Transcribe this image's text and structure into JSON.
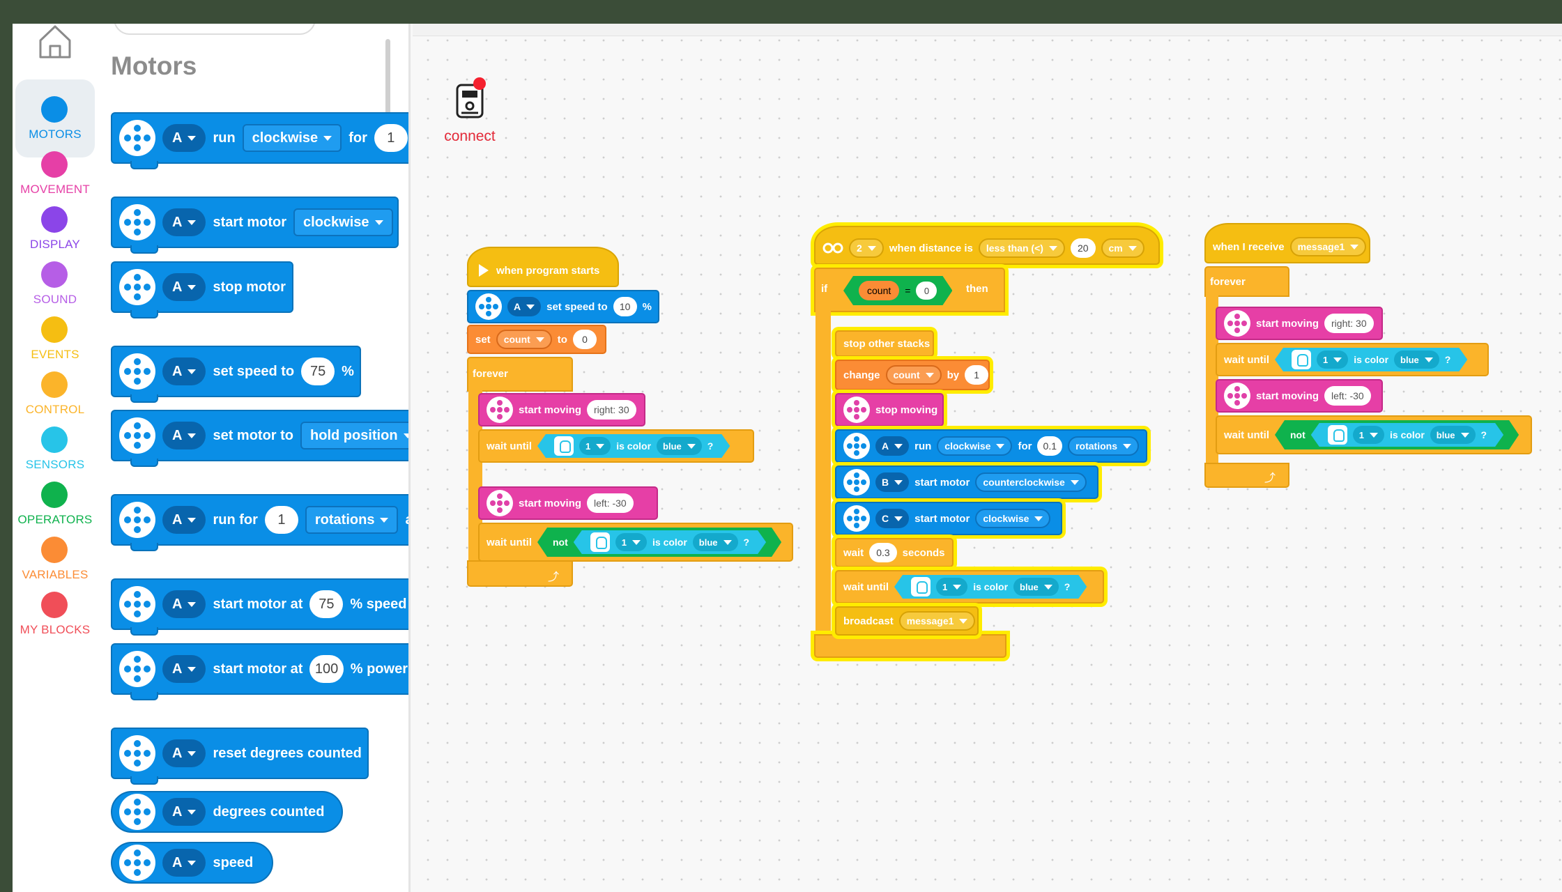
{
  "categories": [
    {
      "label": "MOTORS",
      "color": "#0a8ee6"
    },
    {
      "label": "MOVEMENT",
      "color": "#e63fa6"
    },
    {
      "label": "DISPLAY",
      "color": "#8b45e8"
    },
    {
      "label": "SOUND",
      "color": "#b65ee6"
    },
    {
      "label": "EVENTS",
      "color": "#f5be12"
    },
    {
      "label": "CONTROL",
      "color": "#fbb42a"
    },
    {
      "label": "SENSORS",
      "color": "#27c4e8"
    },
    {
      "label": "OPERATORS",
      "color": "#0fb24d"
    },
    {
      "label": "VARIABLES",
      "color": "#fb8c35"
    },
    {
      "label": "MY BLOCKS",
      "color": "#f04e58"
    }
  ],
  "palette": {
    "title": "Motors",
    "blocks": [
      {
        "port": "A",
        "parts": [
          "run",
          "clockwise",
          "for",
          "1"
        ]
      },
      {
        "port": "A",
        "parts": [
          "start motor",
          "clockwise"
        ]
      },
      {
        "port": "A",
        "parts": [
          "stop motor"
        ]
      },
      {
        "port": "A",
        "parts": [
          "set speed to",
          "75",
          "%"
        ]
      },
      {
        "port": "A",
        "parts": [
          "set motor to",
          "hold position"
        ]
      },
      {
        "port": "A",
        "parts": [
          "run for",
          "1",
          "rotations",
          "a"
        ]
      },
      {
        "port": "A",
        "parts": [
          "start motor at",
          "75",
          "% speed"
        ]
      },
      {
        "port": "A",
        "parts": [
          "start motor at",
          "100",
          "% power"
        ]
      },
      {
        "port": "A",
        "parts": [
          "reset degrees counted"
        ]
      },
      {
        "port": "A",
        "parts": [
          "degrees counted"
        ]
      },
      {
        "port": "A",
        "parts": [
          "speed"
        ]
      }
    ]
  },
  "connect": {
    "label": "connect"
  },
  "stack1": {
    "hat": "when program starts",
    "speed": {
      "port": "A",
      "label": "set speed to",
      "value": "10",
      "unit": "%"
    },
    "set": {
      "label": "set",
      "var": "count",
      "to": "to",
      "value": "0"
    },
    "forever": "forever",
    "move1": {
      "label": "start moving",
      "value": "right: 30"
    },
    "wait1": {
      "label": "wait until",
      "port": "1",
      "is": "is color",
      "color": "blue",
      "q": "?"
    },
    "move2": {
      "label": "start moving",
      "value": "left: -30"
    },
    "wait2": {
      "label": "wait until",
      "not": "not",
      "port": "1",
      "is": "is color",
      "color": "blue",
      "q": "?"
    }
  },
  "stack2": {
    "hat": {
      "port": "2",
      "label": "when distance is",
      "cmp": "less than (<)",
      "value": "20",
      "unit": "cm"
    },
    "if": {
      "label": "if",
      "var": "count",
      "eq": "=",
      "value": "0",
      "then": "then"
    },
    "stop_other": "stop other stacks",
    "change": {
      "label": "change",
      "var": "count",
      "by": "by",
      "value": "1"
    },
    "stop_moving": "stop moving",
    "run": {
      "port": "A",
      "label": "run",
      "dir": "clockwise",
      "for": "for",
      "value": "0.1",
      "unit": "rotations"
    },
    "startB": {
      "port": "B",
      "label": "start motor",
      "dir": "counterclockwise"
    },
    "startC": {
      "port": "C",
      "label": "start motor",
      "dir": "clockwise"
    },
    "wait": {
      "label": "wait",
      "value": "0.3",
      "unit": "seconds"
    },
    "waituntil": {
      "label": "wait until",
      "port": "1",
      "is": "is color",
      "color": "blue",
      "q": "?"
    },
    "broadcast": {
      "label": "broadcast",
      "msg": "message1"
    }
  },
  "stack3": {
    "hat": {
      "label": "when I receive",
      "msg": "message1"
    },
    "forever": "forever",
    "move1": {
      "label": "start moving",
      "value": "right: 30"
    },
    "wait1": {
      "label": "wait until",
      "port": "1",
      "is": "is color",
      "color": "blue",
      "q": "?"
    },
    "move2": {
      "label": "start moving",
      "value": "left: -30"
    },
    "wait2": {
      "label": "wait until",
      "not": "not",
      "port": "1",
      "is": "is color",
      "color": "blue",
      "q": "?"
    }
  }
}
